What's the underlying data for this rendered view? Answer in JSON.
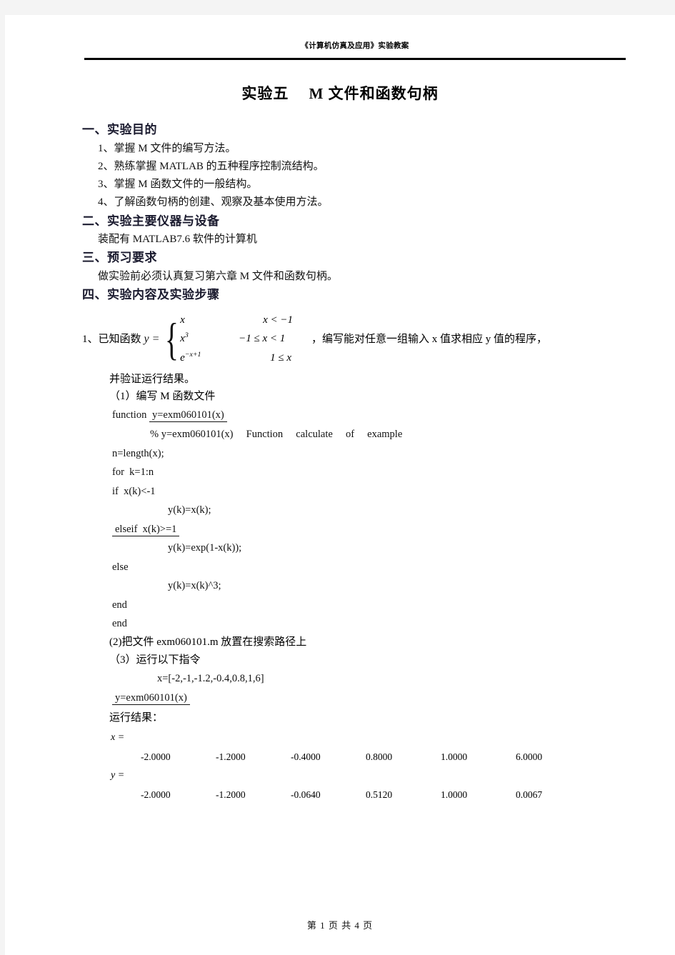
{
  "document": {
    "running_header": "《计算机仿真及应用》实验教案",
    "title_cn": "实验五",
    "title_en_mixed": "M 文件和函数句柄",
    "footer_prefix": "第",
    "footer_page": "1",
    "footer_middle": "页 共",
    "footer_total": "4",
    "footer_suffix": "页"
  },
  "sections": {
    "s1_heading": "一、实验目的",
    "s1_items": [
      "1、掌握 M 文件的编写方法。",
      "2、熟练掌握 MATLAB 的五种程序控制流结构。",
      "3、掌握 M 函数文件的一般结构。",
      "4、了解函数句柄的创建、观察及基本使用方法。"
    ],
    "s2_heading": "二、实验主要仪器与设备",
    "s2_body": "装配有 MATLAB7.6 软件的计算机",
    "s3_heading": "三、预习要求",
    "s3_body": "做实验前必须认真复习第六章 M 文件和函数句柄。",
    "s4_heading": "四、实验内容及实验步骤"
  },
  "problem": {
    "lead": "1、已知函数",
    "y_label": "y =",
    "cases": [
      {
        "expr": "x",
        "exp": "",
        "cond": "x < −1"
      },
      {
        "expr": "x",
        "exp": "3",
        "cond": "−1 ≤ x < 1"
      },
      {
        "expr": "e",
        "exp": "−x+1",
        "cond": "1 ≤ x"
      }
    ],
    "tail": "，编写能对任意一组输入 x 值求相应 y 值的程序，",
    "verify": "并验证运行结果。",
    "step1": "（1）编写 M 函数文件",
    "step2": "(2)把文件 exm060101.m 放置在搜索路径上",
    "step3": "（3）运行以下指令",
    "result_label": "运行结果："
  },
  "code": {
    "lines": [
      {
        "indent": "i1",
        "pre": "function ",
        "underlined": "y=exm060101(x)",
        "post": ""
      },
      {
        "indent": "i2",
        "pre": "% y=exm060101(x)     Function     calculate     of     example",
        "underlined": "",
        "post": ""
      },
      {
        "indent": "i1",
        "pre": "n=length(x);",
        "underlined": "",
        "post": ""
      },
      {
        "indent": "i1",
        "pre": "for  k=1:n",
        "underlined": "",
        "post": ""
      },
      {
        "indent": "i1",
        "pre": "if  x(k)<-1",
        "underlined": "",
        "post": ""
      },
      {
        "indent": "i3",
        "pre": "y(k)=x(k);",
        "underlined": "",
        "post": ""
      },
      {
        "indent": "i0",
        "pre": "",
        "underlined": "elseif  x(k)>=1",
        "post": ""
      },
      {
        "indent": "i3",
        "pre": "y(k)=exp(1-x(k));",
        "underlined": "",
        "post": ""
      },
      {
        "indent": "i1",
        "pre": "else",
        "underlined": "",
        "post": ""
      },
      {
        "indent": "i3",
        "pre": "y(k)=x(k)^3;",
        "underlined": "",
        "post": ""
      },
      {
        "indent": "i1",
        "pre": "end",
        "underlined": "",
        "post": ""
      },
      {
        "indent": "i1",
        "pre": "end",
        "underlined": "",
        "post": ""
      }
    ],
    "commands": [
      {
        "indent": "i4",
        "pre": "x=[-2,-1,-1.2,-0.4,0.8,1,6]",
        "underlined": ""
      },
      {
        "indent": "i0",
        "pre": "",
        "underlined": "y=exm060101(x)"
      }
    ]
  },
  "output": {
    "x_label": "x =",
    "x_values": [
      "-2.0000",
      "-1.2000",
      "-0.4000",
      "0.8000",
      "1.0000",
      "6.0000"
    ],
    "y_label": "y =",
    "y_values": [
      "-2.0000",
      "-1.2000",
      "-0.0640",
      "0.5120",
      "1.0000",
      "0.0067"
    ]
  }
}
